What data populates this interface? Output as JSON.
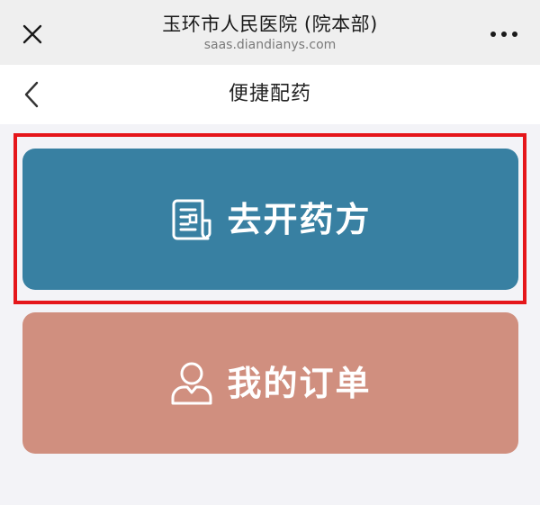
{
  "header": {
    "title": "玉环市人民医院 (院本部)",
    "url": "saas.diandianys.com",
    "close_icon": "close-icon",
    "more_icon": "more-dots-icon"
  },
  "nav": {
    "back_icon": "chevron-left-icon",
    "title": "便捷配药"
  },
  "actions": [
    {
      "label": "去开药方",
      "icon": "prescription-document-icon",
      "color": "#3880a2",
      "highlighted": true
    },
    {
      "label": "我的订单",
      "icon": "user-icon",
      "color": "#d08f7f",
      "highlighted": false
    }
  ],
  "colors": {
    "highlight_border": "#e5161b",
    "page_background": "#f3f3f7",
    "topbar_background": "#efefef"
  }
}
